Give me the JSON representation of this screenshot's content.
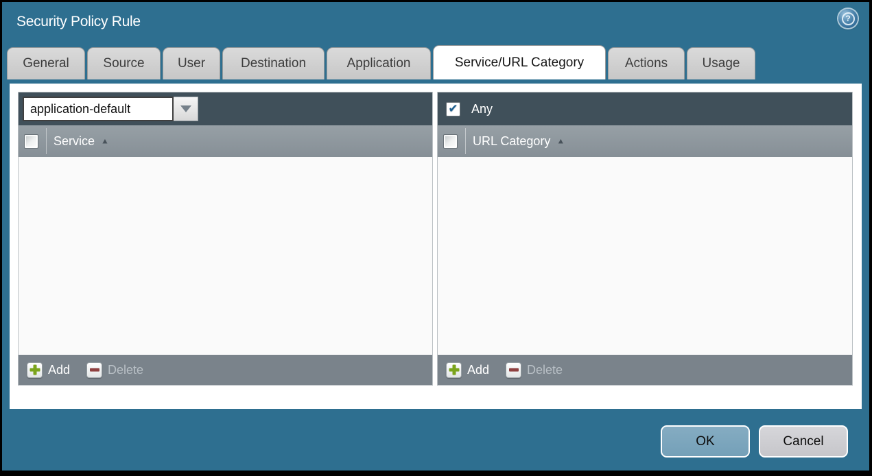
{
  "window": {
    "title": "Security Policy Rule"
  },
  "help": {
    "glyph": "?"
  },
  "tabs": [
    {
      "label": "General",
      "active": false
    },
    {
      "label": "Source",
      "active": false
    },
    {
      "label": "User",
      "active": false
    },
    {
      "label": "Destination",
      "active": false
    },
    {
      "label": "Application",
      "active": false
    },
    {
      "label": "Service/URL Category",
      "active": true
    },
    {
      "label": "Actions",
      "active": false
    },
    {
      "label": "Usage",
      "active": false
    }
  ],
  "service_panel": {
    "dropdown": {
      "value": "application-default"
    },
    "select_all_checked": false,
    "column_header": {
      "label": "Service",
      "sort_glyph": "▲",
      "sort": "asc"
    },
    "rows": [],
    "footer": {
      "add_label": "Add",
      "delete_label": "Delete",
      "delete_enabled": false
    }
  },
  "url_panel": {
    "any_label": "Any",
    "any_checked": true,
    "check_glyph": "✔",
    "select_all_checked": false,
    "column_header": {
      "label": "URL Category",
      "sort_glyph": "▲",
      "sort": "asc"
    },
    "rows": [],
    "footer": {
      "add_label": "Add",
      "delete_label": "Delete",
      "delete_enabled": false
    }
  },
  "actions": {
    "ok_label": "OK",
    "cancel_label": "Cancel"
  },
  "colors": {
    "dialog_background": "#2e6f90",
    "dark_header": "#40505a",
    "column_header": "#8d969d",
    "footer_bar": "#7a838b",
    "add_green": "#7ba41c",
    "delete_red": "#8f4040",
    "check_blue": "#1d5e8e",
    "ok_button": "#7aa3ba",
    "cancel_button": "#cdcdd1"
  }
}
